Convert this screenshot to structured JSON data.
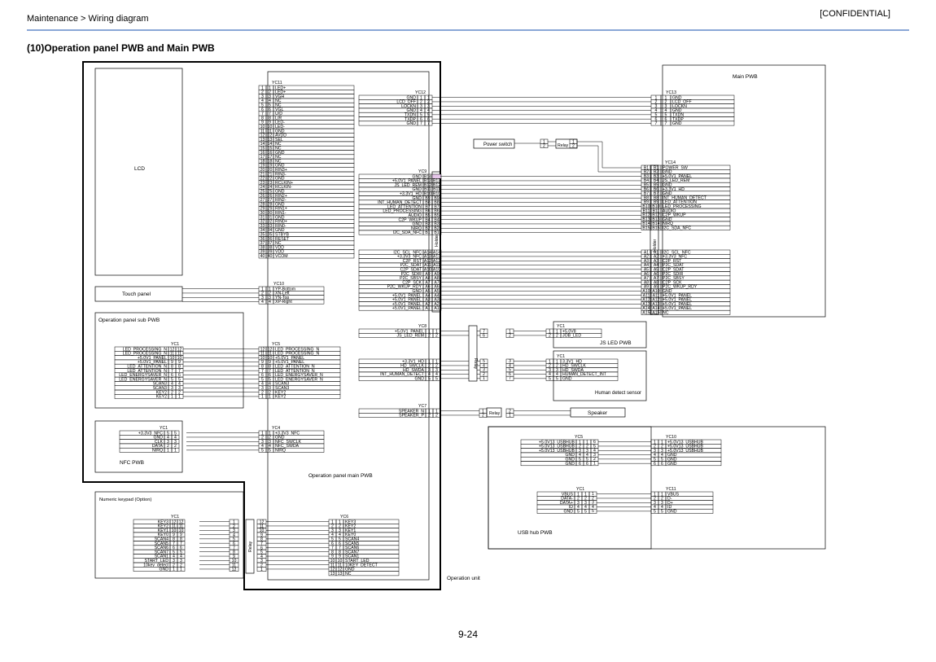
{
  "header": {
    "breadcrumb": "Maintenance > Wiring diagram",
    "confidential": "[CONFIDENTIAL]",
    "section_title": "(10)Operation panel PWB and Main PWB",
    "page_number": "9-24"
  },
  "labels": {
    "lcd": "LCD",
    "touch_panel": "Touch panel",
    "op_panel_sub": "Operation panel sub PWB",
    "nfc_pwb": "NFC PWB",
    "numeric_keypad": "Numeric keypad (Option)",
    "op_panel_main": "Operation panel main PWB",
    "operation_unit": "Operation unit",
    "main_pwb": "Main PWB",
    "power_switch": "Power switch",
    "relay": "Relay",
    "holder": "Holder",
    "js_led_pwb": "JS LED PWB",
    "human_detect": "Human detect sensor",
    "speaker": "Speaker",
    "usb_hub": "USB hub PWB"
  },
  "connectors": {
    "yc11": {
      "name": "YC11",
      "signals": [
        "LED+",
        "LED+",
        "VGH",
        "NC",
        "NC",
        "VGL",
        "U/D",
        "L/R",
        "LED-",
        "LED-",
        "GND",
        "AVDD",
        "SEL",
        "NC",
        "NC",
        "GND",
        "NC",
        "NC",
        "GND",
        "RIN3+",
        "RIN3-",
        "GND",
        "RCLKIN+",
        "RCLKIN-",
        "GND",
        "RIN2+",
        "RIN2-",
        "GND",
        "RIN1+",
        "RIN1-",
        "GND",
        "RIN0+",
        "RIN0-",
        "GND",
        "STBYB",
        "RESET",
        "NC",
        "VDD",
        "VDD",
        "VCOM"
      ]
    },
    "yc10": {
      "name": "YC10",
      "signals": [
        "YP-Bottom",
        "XN-Left",
        "YN-Top",
        "XP-Right"
      ]
    },
    "yc12": {
      "name": "YC12",
      "signals": [
        "GND",
        "LCD_OFF",
        "LOCKN",
        "GND",
        "TXDN",
        "TXDP",
        "GND"
      ]
    },
    "yc13": {
      "name": "YC13",
      "signals": [
        "GND",
        "LCD_OFF",
        "LOCKN",
        "GND",
        "TXDN",
        "TXDP",
        "GND"
      ]
    },
    "yc9b": {
      "name": "YC9",
      "signals": [
        "GND",
        "+5.0V1_PANEL",
        "JS_LED_REM",
        "GND",
        "+3.3V1_HD",
        "GND",
        "INT_HUMAN_DETECT",
        "LED_ATTENTION",
        "LED_PROCESSING",
        "AUDIO",
        "C2P_WKUP",
        "GND",
        "NIRQ",
        "I2C_SDA_NFC"
      ],
      "pins": [
        "B14",
        "B13",
        "B12",
        "B11",
        "B10",
        "B9",
        "B8",
        "B7",
        "B6",
        "B5",
        "B4",
        "B3",
        "B2",
        "B1"
      ]
    },
    "yc9a": {
      "signals": [
        "I2C_SCL_NFC",
        "+3.3V3_NFC",
        "C2P_RST",
        "P2C_SDAT",
        "C2P_SDAT",
        "P2C_SDIR",
        "P2C_SBSY",
        "C2P_SCK",
        "P2C_WKUP_RDY",
        "GND",
        "+5.0V1_PANEL",
        "+5.0V1_PANEL",
        "+5.0V1_PANEL",
        "+5.0V1_PANEL"
      ],
      "pins": [
        "A14",
        "A13",
        "A12",
        "A11",
        "A10",
        "A9",
        "A8",
        "A7",
        "A6",
        "A5",
        "A4",
        "A3",
        "A2",
        "A1"
      ]
    },
    "yc14b": {
      "name": "YC14",
      "signals": [
        "POWER_SW",
        "GND",
        "+5.0V1_PANEL",
        "JS_LED_REM",
        "GND",
        "+3.3V1_HD",
        "GND",
        "INT_HUMAN_DETECT",
        "LED_ATTENTION",
        "LED_PROCESSING",
        "AUDIO",
        "C2P_WKUP",
        "GND",
        "NIRQ",
        "I2C_SDA_NFC"
      ],
      "pins": [
        "B1",
        "B2",
        "B3",
        "B4",
        "B5",
        "B6",
        "B7",
        "B8",
        "B9",
        "B10",
        "B11",
        "B12",
        "B13",
        "B14",
        "B15"
      ]
    },
    "yc14a": {
      "signals": [
        "I2C_SCL_NFC",
        "+3.3V3_NFC",
        "C2P_RST",
        "P2C_SDAT",
        "C2P_SDAT",
        "P2C_SDIR",
        "P2C_SBSY",
        "C2P_SCK",
        "P2C_WKUP_RDY",
        "GND",
        "+5.0V1_PANEL",
        "+5.0V1_PANEL",
        "+5.0V1_PANEL",
        "+5.0V1_PANEL",
        "NC"
      ],
      "pins": [
        "A1",
        "A2",
        "A3",
        "A4",
        "A5",
        "A6",
        "A7",
        "A8",
        "A9",
        "A10",
        "A11",
        "A12",
        "A13",
        "A14",
        "A15"
      ]
    },
    "yc8a": {
      "name": "YC8",
      "signals": [
        "+5.0V1_PANEL",
        "JS_LED_REM"
      ]
    },
    "yc8b": {
      "signals": [
        "+3.3V1_HD",
        "HD_SWCLK",
        "HD_SWDA",
        "INT_HUMAN_DETECT",
        "GND"
      ]
    },
    "yc7": {
      "name": "YC7",
      "signals": [
        "SPEAKER_N",
        "SPEAKER_P"
      ]
    },
    "js_yc1": {
      "name": "YC1",
      "signals": [
        "+5.0V8",
        "JOB_LED"
      ]
    },
    "hd_yc1": {
      "name": "YC1",
      "signals": [
        "3.3V1_HD",
        "HD_SWCLK",
        "HD_SWDA",
        "HUMAN_DETECT_INT",
        "GND"
      ]
    },
    "sub_yc1": {
      "name": "YC1",
      "signals": [
        "LED_PROCESSING_N",
        "LED_PROCESSING_N",
        "+5.0V1_PANEL",
        "+5.0V1_PANEL",
        "LED_ATTENTION_N",
        "LED_ATTENTION_N",
        "LED_ENERGYSAVER_N",
        "LED_ENERGYSAVER_N",
        "SCAN3",
        "SCAN3",
        "KEY2",
        "KEY2"
      ]
    },
    "yc5": {
      "name": "YC5",
      "signals": [
        "LED_PROCESSING_N",
        "LED_PROCESSING_N",
        "+5.0V1_PANEL",
        "+5.0V1_PANEL",
        "LED_ATTENTION_N",
        "LED_ATTENTION_N",
        "LED_ENERGYSAVER_N",
        "LED_ENERGYSAVER_N",
        "SCAN3",
        "SCAN3",
        "KEY2",
        "KEY2"
      ]
    },
    "nfc_yc1": {
      "name": "YC1",
      "signals": [
        "+3.3V3_NFC",
        "GND",
        "CLK",
        "DATA",
        "NIRQ"
      ]
    },
    "yc4": {
      "name": "YC4",
      "signals": [
        "+3.3V3_NFC",
        "GND",
        "NFC_SWCLK",
        "NFC_SWDA",
        "NIRQ"
      ]
    },
    "usb_yc5": {
      "name": "YC5",
      "signals": [
        "+5.0V13_USBHUB",
        "+5.0V13_USBHUB",
        "+5.0V13_USBHUB",
        "GND",
        "GND",
        "GND"
      ]
    },
    "yc10b": {
      "name": "YC10",
      "signals": [
        "+5.0V13_USBHUB",
        "+5.0V13_USBHUB",
        "+5.0V13_USBHUB",
        "GND",
        "GND",
        "GND"
      ]
    },
    "usb_yc1": {
      "name": "YC1",
      "signals": [
        "VBUS",
        "DATA-",
        "DATA+",
        "ID",
        "GND"
      ]
    },
    "yc11b": {
      "name": "YC11",
      "signals": [
        "VBUS",
        "D-",
        "D+",
        "ID",
        "GND"
      ]
    },
    "key_yc1": {
      "name": "YC1",
      "signals": [
        "KEY3",
        "KEY2",
        "KEY1",
        "KEY0",
        "SCAN4",
        "SCAN5",
        "SCAN6",
        "SCAN7",
        "SCAN1",
        "START_LED",
        "10key_detect",
        "GND"
      ]
    },
    "yc6": {
      "name": "YC6",
      "signals": [
        "KEY3",
        "KEY2",
        "KEY1",
        "KEY0",
        "SCAN4",
        "SCAN5",
        "SCAN6",
        "SCAN7",
        "SCAN1",
        "START_LED",
        "10KEY_DETECT",
        "GND",
        "NC"
      ]
    }
  },
  "colors": {
    "header_rule": "#8aa7d6",
    "line": "#000000",
    "highlight": "#e6c6ea"
  }
}
